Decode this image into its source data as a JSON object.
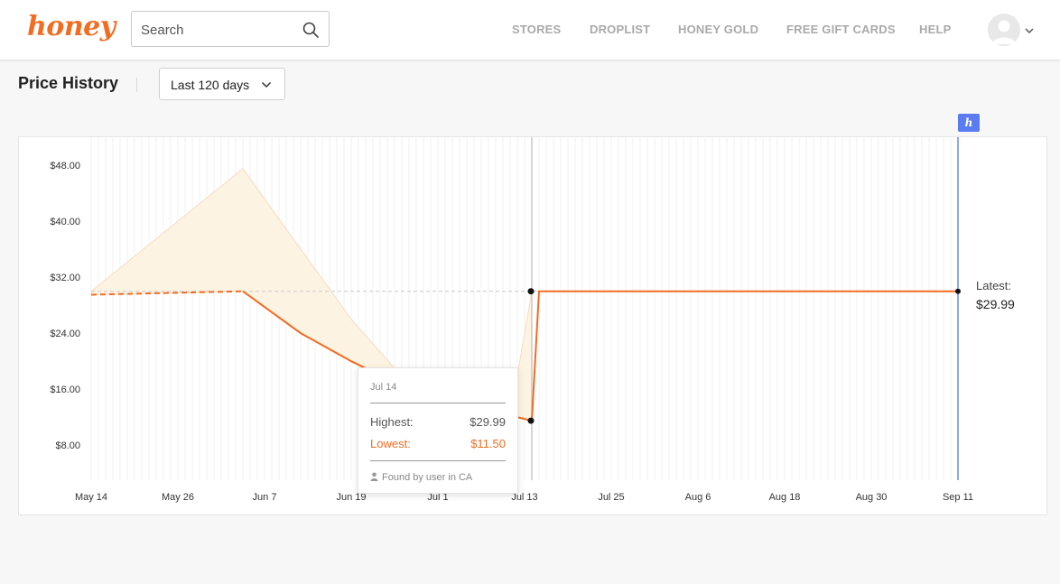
{
  "header": {
    "logo": "honey",
    "search": {
      "placeholder": "Search",
      "value": ""
    },
    "nav": [
      "STORES",
      "DROPLIST",
      "HONEY GOLD",
      "FREE GIFT CARDS",
      "HELP"
    ]
  },
  "price_history": {
    "title": "Price History",
    "range_label": "Last 120 days"
  },
  "chart_data": {
    "type": "line",
    "y_ticks": [
      "$48.00",
      "$40.00",
      "$32.00",
      "$24.00",
      "$16.00",
      "$8.00"
    ],
    "y_tick_values": [
      48,
      40,
      32,
      24,
      16,
      8
    ],
    "x_ticks": [
      "May 14",
      "May 26",
      "Jun 7",
      "Jun 19",
      "Jul 1",
      "Jul 13",
      "Jul 25",
      "Aug 6",
      "Aug 18",
      "Aug 30",
      "Sep 11"
    ],
    "ylim": [
      3,
      52
    ],
    "xlim": [
      "2024-05-14",
      "2024-09-11"
    ],
    "series": [
      {
        "name": "Highest",
        "points": [
          [
            "2024-05-14",
            30.0
          ],
          [
            "2024-06-04",
            47.5
          ],
          [
            "2024-06-12",
            36.0
          ],
          [
            "2024-06-19",
            26.0
          ],
          [
            "2024-06-25",
            19.0
          ],
          [
            "2024-07-01",
            14.0
          ],
          [
            "2024-07-09",
            11.5
          ],
          [
            "2024-07-12",
            18.0
          ],
          [
            "2024-07-14",
            29.99
          ],
          [
            "2024-09-11",
            29.99
          ]
        ]
      },
      {
        "name": "Lowest",
        "points": [
          [
            "2024-05-14",
            29.5
          ],
          [
            "2024-06-04",
            29.99
          ],
          [
            "2024-06-12",
            24.0
          ],
          [
            "2024-06-19",
            20.0
          ],
          [
            "2024-06-25",
            17.0
          ],
          [
            "2024-06-30",
            15.0
          ],
          [
            "2024-07-14",
            11.5
          ],
          [
            "2024-07-15",
            29.99
          ],
          [
            "2024-09-11",
            29.99
          ]
        ]
      }
    ],
    "reference_value": 29.99,
    "highlight_date": "2024-07-14",
    "latest_date": "2024-09-11",
    "colors": {
      "lowest": "#f26c21",
      "range_fill": "#fdf3e2",
      "latest_line": "#8aa8f5",
      "highlight_line": "#c8c8c8"
    }
  },
  "latest": {
    "label": "Latest:",
    "value": "$29.99"
  },
  "tooltip": {
    "date": "Jul 14",
    "highest_label": "Highest:",
    "highest_value": "$29.99",
    "lowest_label": "Lowest:",
    "lowest_value": "$11.50",
    "found_by": "Found by user in CA"
  },
  "icons": {
    "search": "search-icon",
    "avatar": "user-avatar-icon",
    "chevron": "chevron-down-icon",
    "honey_flag": "honey-h-icon",
    "person": "person-icon"
  }
}
